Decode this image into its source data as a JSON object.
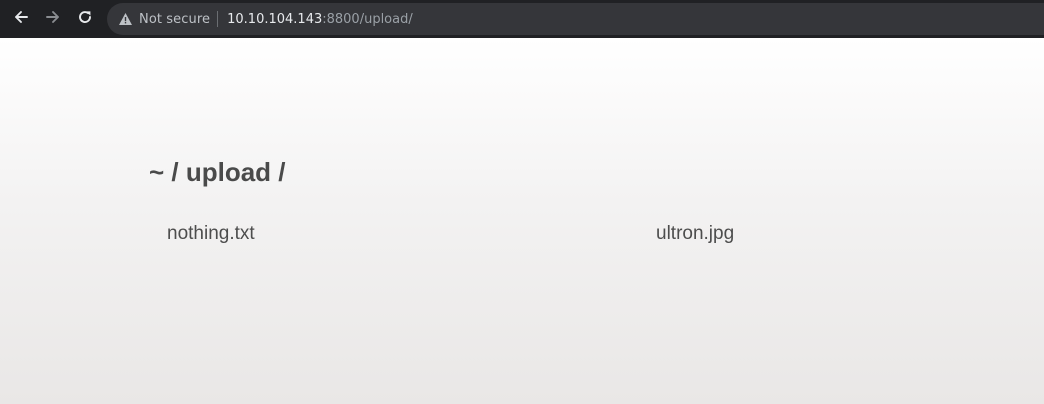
{
  "browser": {
    "security_label": "Not secure",
    "url_host": "10.10.104.143",
    "url_rest": ":8800/upload/",
    "icons": [
      "back-icon",
      "forward-icon",
      "reload-icon",
      "warning-icon"
    ]
  },
  "page": {
    "title": "~ / upload /",
    "files": [
      {
        "name": "nothing.txt"
      },
      {
        "name": "ultron.jpg"
      }
    ]
  }
}
